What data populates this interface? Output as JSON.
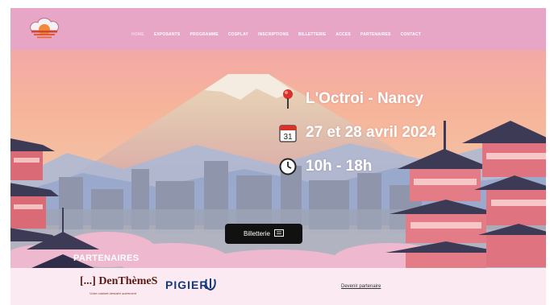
{
  "nav": {
    "items": [
      "HOME",
      "EXPOSANTS",
      "PROGRAMME",
      "COSPLAY",
      "INSCRIPTIONS",
      "BILLETTERIE",
      "ACCES",
      "PARTENAIRES",
      "CONTACT"
    ]
  },
  "event": {
    "location": "L'Octroi - Nancy",
    "dates": "27 et 28 avril 2024",
    "hours": "10h - 18h",
    "calendar_day": "31"
  },
  "billetterie_label": "Billetterie",
  "partners": {
    "title": "PARTENAIRES",
    "denthemes_logo": "[...] DenThèmeS",
    "denthemes_tagline": "Votre cabinet dentaire autrement",
    "pigier_logo": "PIGIER",
    "become_partner": "Devenir partenaire"
  },
  "colors": {
    "nav_bg": "#e7a6c6",
    "sky_top": "#f4a9a6",
    "sky_mid": "#f6bf95",
    "button_bg": "#111111"
  }
}
